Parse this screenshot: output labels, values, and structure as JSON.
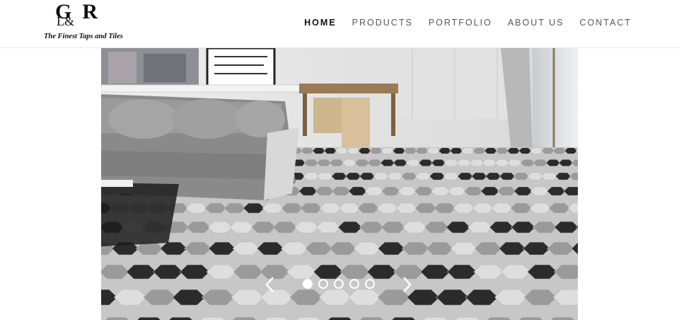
{
  "brand": {
    "logo_text": "G&R",
    "tagline": "The Finest Taps and Tiles"
  },
  "nav": {
    "items": [
      {
        "label": "HOME",
        "active": true
      },
      {
        "label": "PRODUCTS",
        "active": false
      },
      {
        "label": "PORTFOLIO",
        "active": false
      },
      {
        "label": "ABOUT US",
        "active": false
      },
      {
        "label": "CONTACT",
        "active": false
      }
    ]
  },
  "slider": {
    "slide_count": 5,
    "active_slide": 1,
    "prev_icon": "chevron-left-icon",
    "next_icon": "chevron-right-icon",
    "image_description_name": "hexagon-tile-living-room-image"
  },
  "colors": {
    "text_dark": "#111111",
    "nav_text": "#555555",
    "tile_black": "#2b2b2b",
    "tile_mid": "#9a9a9a",
    "tile_light": "#dedede"
  }
}
